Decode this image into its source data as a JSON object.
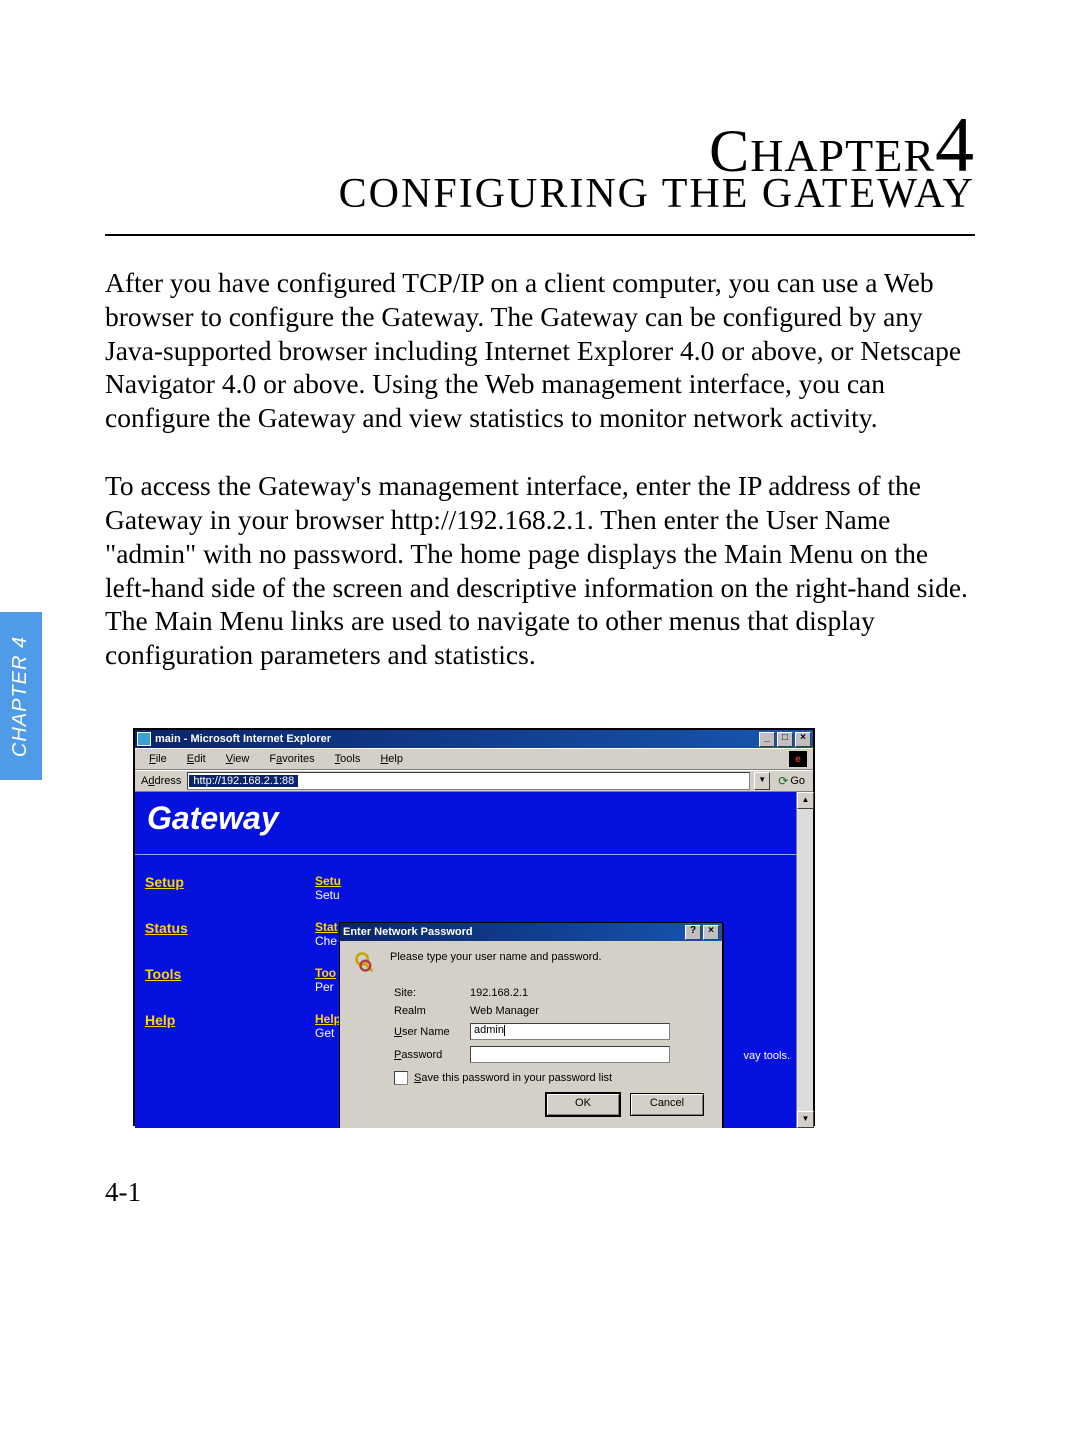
{
  "chapter": {
    "prefix": "Chapter",
    "number": "4",
    "title": "CONFIGURING THE GATEWAY"
  },
  "paragraphs": {
    "p1": "After you have configured TCP/IP on a client computer, you can use a Web browser to configure the Gateway. The Gateway can be configured by any Java-supported browser including Internet Explorer 4.0 or above, or Netscape Navigator 4.0 or above. Using the Web management interface, you can configure the Gateway and view statistics to monitor network activity.",
    "p2": "To access the Gateway's management interface, enter the IP address of the Gateway in your browser http://192.168.2.1. Then enter the User Name \"admin\" with no password. The home page displays the Main Menu on the left-hand side of the screen and descriptive information on the right-hand side. The Main Menu links are used to navigate to other menus that display configuration parameters and statistics."
  },
  "side_tab": "CHAPTER 4",
  "page_number": "4-1",
  "ie": {
    "title": "main - Microsoft Internet Explorer",
    "tb_buttons": {
      "min": "_",
      "max": "□",
      "close": "×"
    },
    "menu": {
      "file": "File",
      "edit": "Edit",
      "view": "View",
      "favorites": "Favorites",
      "tools": "Tools",
      "help": "Help"
    },
    "address_label": "Address",
    "url": "http://192.168.2.1:88",
    "go": "Go",
    "scroll_up": "▲",
    "scroll_down": "▼",
    "dd_arrow": "▼"
  },
  "gateway": {
    "brand": "Gateway",
    "sidebar": {
      "setup": "Setup",
      "status": "Status",
      "tools": "Tools",
      "help": "Help"
    },
    "col": {
      "setup_link": "Setu",
      "setup_sub": "Setu",
      "status_link": "Stat",
      "status_sub": "Che",
      "tools_link": "Too",
      "tools_sub": "Per",
      "help_link": "Help",
      "help_sub": "Get"
    },
    "right_hint": "vay tools."
  },
  "login": {
    "title": "Enter Network Password",
    "help_btn": "?",
    "close_btn": "×",
    "prompt": "Please type your user name and password.",
    "site_label": "Site:",
    "site_value": "192.168.2.1",
    "realm_label": "Realm",
    "realm_value": "Web Manager",
    "user_label": "User Name",
    "user_value": "admin",
    "pass_label": "Password",
    "save_label": "Save this password in your password list",
    "ok": "OK",
    "cancel": "Cancel"
  }
}
